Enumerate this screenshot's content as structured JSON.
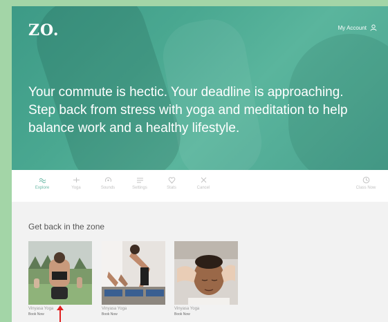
{
  "header": {
    "logo": "ZO.",
    "account_label": "My Account"
  },
  "hero": {
    "headline": "Your commute is hectic. Your deadline is approaching. Step back from stress with yoga and meditation to help balance work and a healthy lifestyle."
  },
  "nav": {
    "items": [
      {
        "label": "Explore",
        "icon": "explore-icon"
      },
      {
        "label": "Yoga",
        "icon": "yoga-icon"
      },
      {
        "label": "Sounds",
        "icon": "sounds-icon"
      },
      {
        "label": "Settings",
        "icon": "settings-icon"
      },
      {
        "label": "Stats",
        "icon": "stats-icon"
      },
      {
        "label": "Cancel",
        "icon": "close-icon"
      }
    ],
    "right_item": {
      "label": "Class Now",
      "icon": "clock-icon"
    }
  },
  "section": {
    "title": "Get back in the zone"
  },
  "cards": [
    {
      "title": "Vinyasa Yoga",
      "link": "Book Now"
    },
    {
      "title": "Vinyasa Yoga",
      "link": "Book Now"
    },
    {
      "title": "Vinyasa Yoga",
      "link": "Book Now"
    }
  ],
  "colors": {
    "hero_overlay": "#4aa891",
    "accent": "#6ab9a6",
    "annotation_arrow": "#e02020",
    "frame_background": "#a3d5a7"
  }
}
